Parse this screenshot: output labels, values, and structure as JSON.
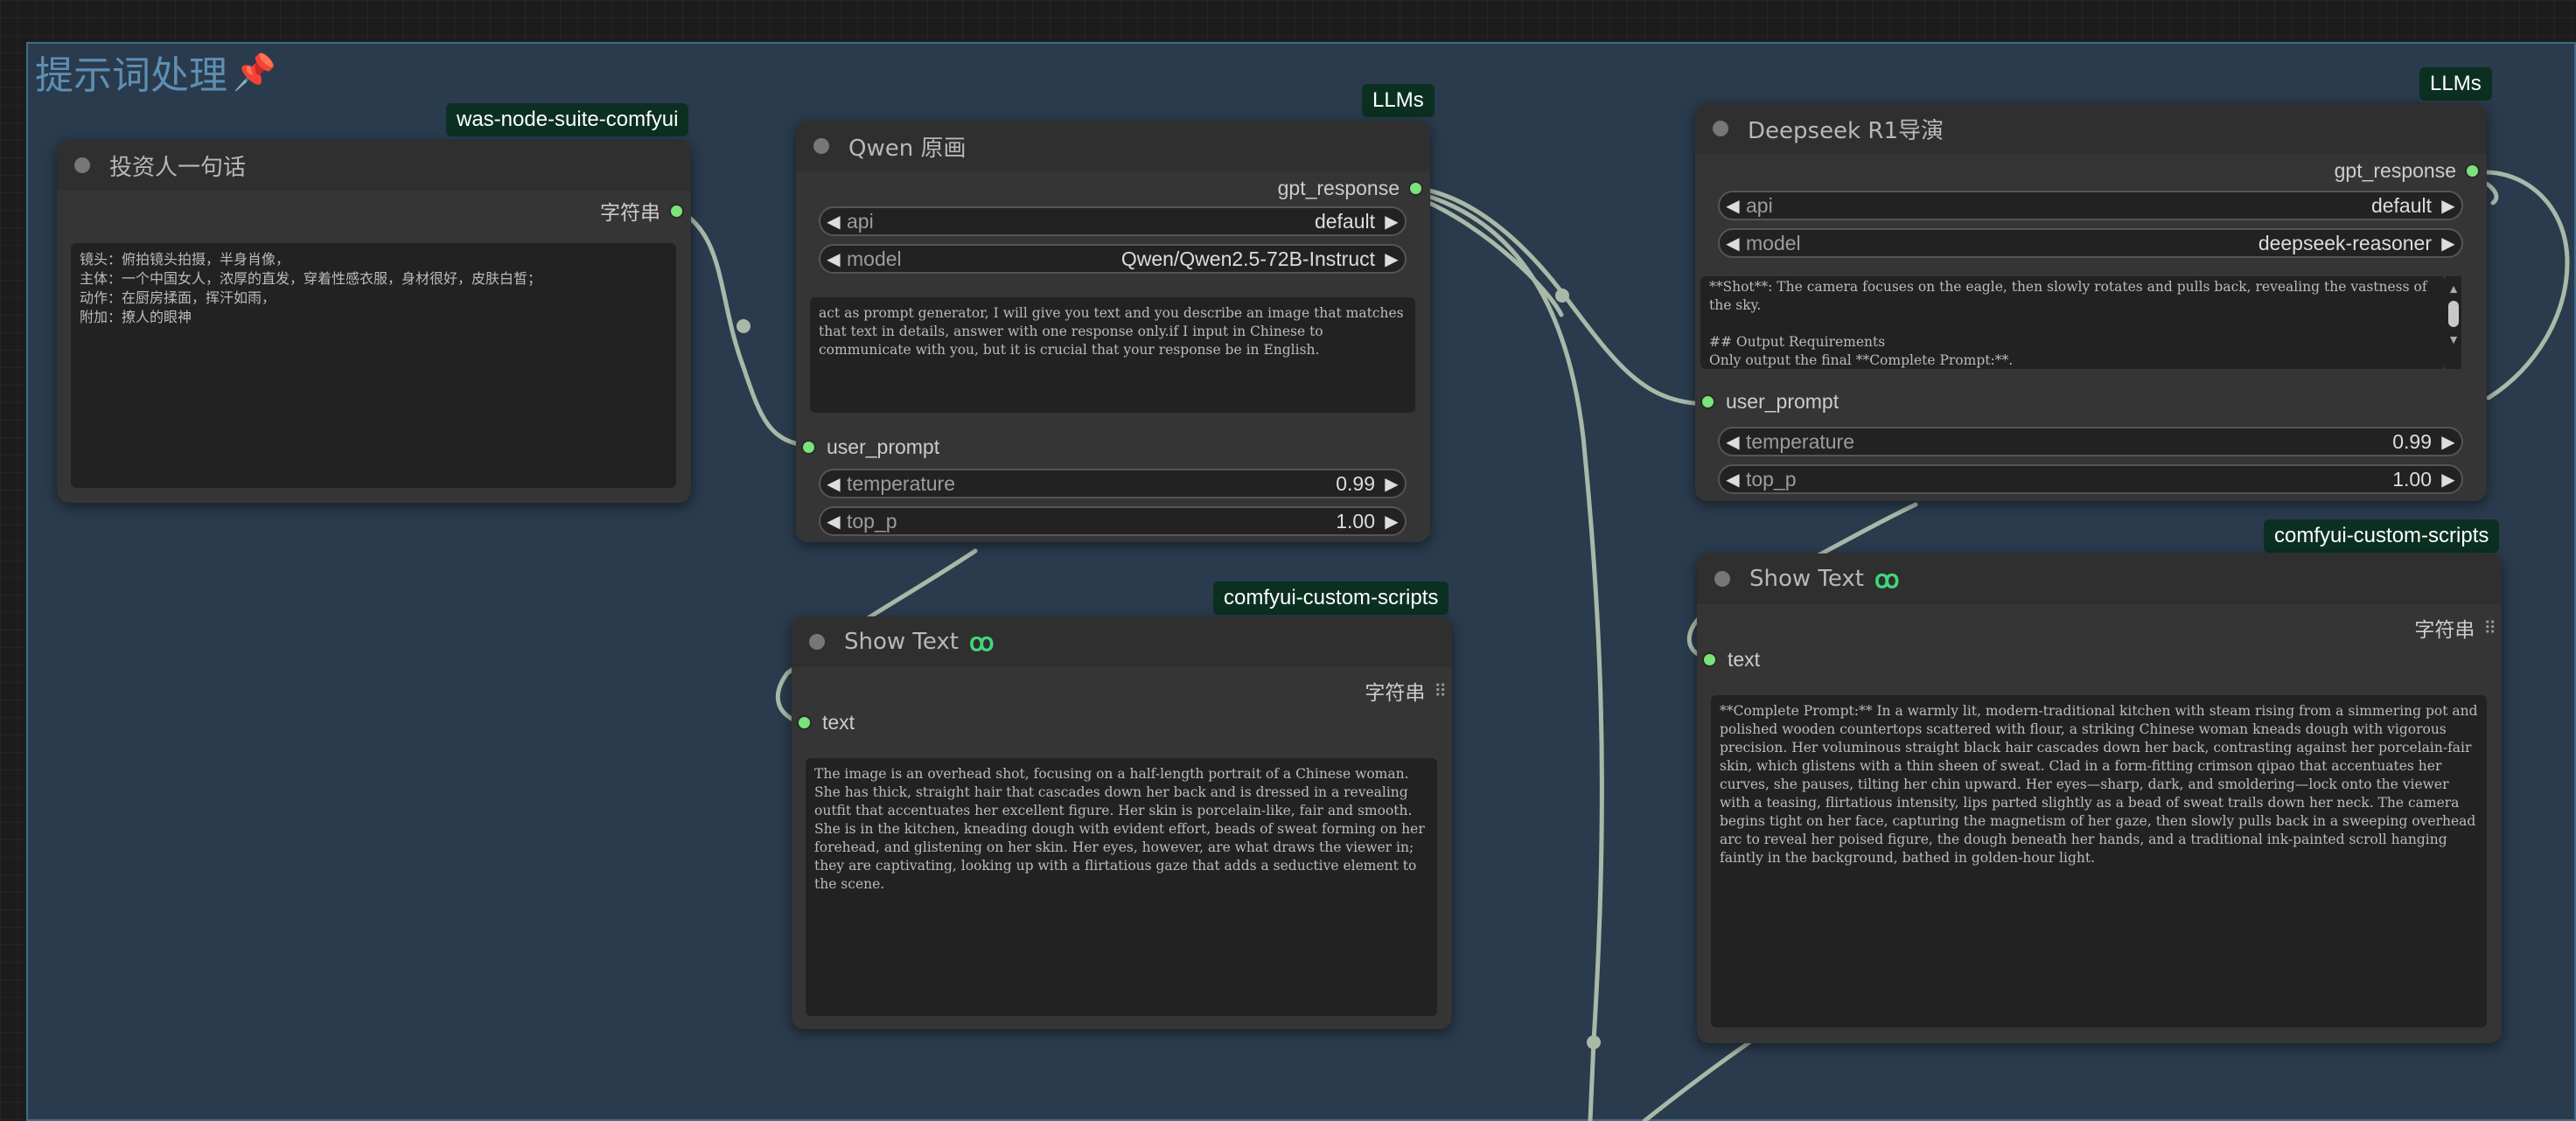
{
  "group": {
    "title": "提示词处理",
    "pin_icon": "pushpin-icon"
  },
  "nodes": {
    "investor": {
      "title": "投资人一句话",
      "badge": "was-node-suite-comfyui",
      "output_label": "字符串",
      "text": "镜头：俯拍镜头拍摄，半身肖像，\n主体：一个中国女人，浓厚的直发，穿着性感衣服，身材很好，皮肤白皙；\n动作：在厨房揉面，挥汗如雨，\n附加：撩人的眼神"
    },
    "qwen": {
      "title": "Qwen 原画",
      "badge": "LLMs",
      "output_label": "gpt_response",
      "api_label": "api",
      "api_value": "default",
      "model_label": "model",
      "model_value": "Qwen/Qwen2.5-72B-Instruct",
      "prompt": "act as prompt generator, I will give you text and you describe an image that matches that text in details, answer with one response only.if I input in Chinese to communicate with you, but it is crucial that your response be in English.",
      "input_label": "user_prompt",
      "temperature_label": "temperature",
      "temperature_value": "0.99",
      "top_p_label": "top_p",
      "top_p_value": "1.00"
    },
    "deepseek": {
      "title": "Deepseek R1导演",
      "badge": "LLMs",
      "output_label": "gpt_response",
      "api_label": "api",
      "api_value": "default",
      "model_label": "model",
      "model_value": "deepseek-reasoner",
      "prompt": "**Shot**: The camera focuses on the eagle, then slowly rotates and pulls back, revealing the vastness of the sky.\n\n## Output Requirements\nOnly output the final **Complete Prompt:**.",
      "input_label": "user_prompt",
      "temperature_label": "temperature",
      "temperature_value": "0.99",
      "top_p_label": "top_p",
      "top_p_value": "1.00"
    },
    "show_text_1": {
      "title": "Show Text",
      "badge": "comfyui-custom-scripts",
      "output_label": "字符串",
      "input_label": "text",
      "text": "The image is an overhead shot, focusing on a half-length portrait of a Chinese woman. She has thick, straight hair that cascades down her back and is dressed in a revealing outfit that accentuates her excellent figure. Her skin is porcelain-like, fair and smooth. She is in the kitchen, kneading dough with evident effort, beads of sweat forming on her forehead, and glistening on her skin. Her eyes, however, are what draws the viewer in; they are captivating, looking up with a flirtatious gaze that adds a seductive element to the scene."
    },
    "show_text_2": {
      "title": "Show Text",
      "badge": "comfyui-custom-scripts",
      "output_label": "字符串",
      "input_label": "text",
      "text": "**Complete Prompt:** In a warmly lit, modern-traditional kitchen with steam rising from a simmering pot and polished wooden countertops scattered with flour, a striking Chinese woman kneads dough with vigorous precision. Her voluminous straight black hair cascades down her back, contrasting against her porcelain-fair skin, which glistens with a thin sheen of sweat. Clad in a form-fitting crimson qipao that accentuates her curves, she pauses, tilting her chin upward. Her eyes—sharp, dark, and smoldering—lock onto the viewer with a teasing, flirtatious intensity, lips parted slightly as a bead of sweat trails down her neck. The camera begins tight on her face, capturing the magnetism of her gaze, then slowly pulls back in a sweeping overhead arc to reveal her poised figure, the dough beneath her hands, and a traditional ink-painted scroll hanging faintly in the background, bathed in golden-hour light."
    }
  },
  "colors": {
    "canvas": "#1c1c1c",
    "group_bg": "#2a3b4d",
    "group_border": "#3f6c8c",
    "group_title": "#5f8eb4",
    "node_bg": "#353535",
    "badge_bg": "#0b3021",
    "slot": "#7be37b",
    "wire": "#a9b9a8"
  }
}
